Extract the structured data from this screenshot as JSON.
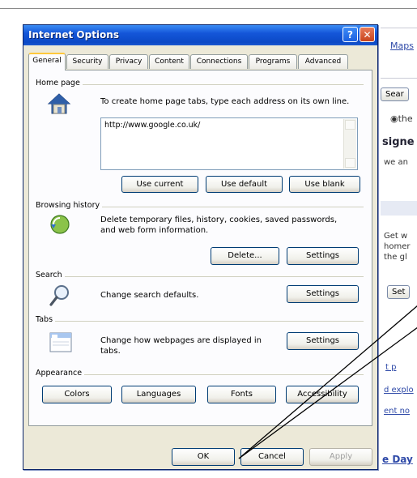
{
  "dialog": {
    "title": "Internet Options",
    "tabs": [
      {
        "label": "General"
      },
      {
        "label": "Security"
      },
      {
        "label": "Privacy"
      },
      {
        "label": "Content"
      },
      {
        "label": "Connections"
      },
      {
        "label": "Programs"
      },
      {
        "label": "Advanced"
      }
    ],
    "home_page": {
      "heading": "Home page",
      "description": "To create home page tabs, type each address on its own line.",
      "address": "http://www.google.co.uk/",
      "use_current": "Use current",
      "use_default": "Use default",
      "use_blank": "Use blank"
    },
    "browsing_history": {
      "heading": "Browsing history",
      "description": "Delete temporary files, history, cookies, saved passwords, and web form information.",
      "delete": "Delete...",
      "settings": "Settings"
    },
    "search": {
      "heading": "Search",
      "description": "Change search defaults.",
      "settings": "Settings"
    },
    "tabs_section": {
      "heading": "Tabs",
      "description": "Change how webpages are displayed in tabs.",
      "settings": "Settings"
    },
    "appearance": {
      "heading": "Appearance",
      "colors": "Colors",
      "languages": "Languages",
      "fonts": "Fonts",
      "accessibility": "Accessibility"
    },
    "footer": {
      "ok": "OK",
      "cancel": "Cancel",
      "apply": "Apply"
    }
  },
  "background": {
    "link_top": "Maps",
    "search_btn": "Sear",
    "radio_label": "the",
    "bold_text": "signe",
    "small_text": "we an",
    "paragraph": [
      "Get w",
      "homer",
      "the gl"
    ],
    "set_btn": "Set",
    "links": [
      "t p",
      "d explo",
      "ent no"
    ],
    "bottom_link": "e Day"
  },
  "colors": {
    "title_bar": "#0b49c6",
    "dialog_bg": "#ece9d8",
    "active_tab_accent": "#ffc83c"
  }
}
